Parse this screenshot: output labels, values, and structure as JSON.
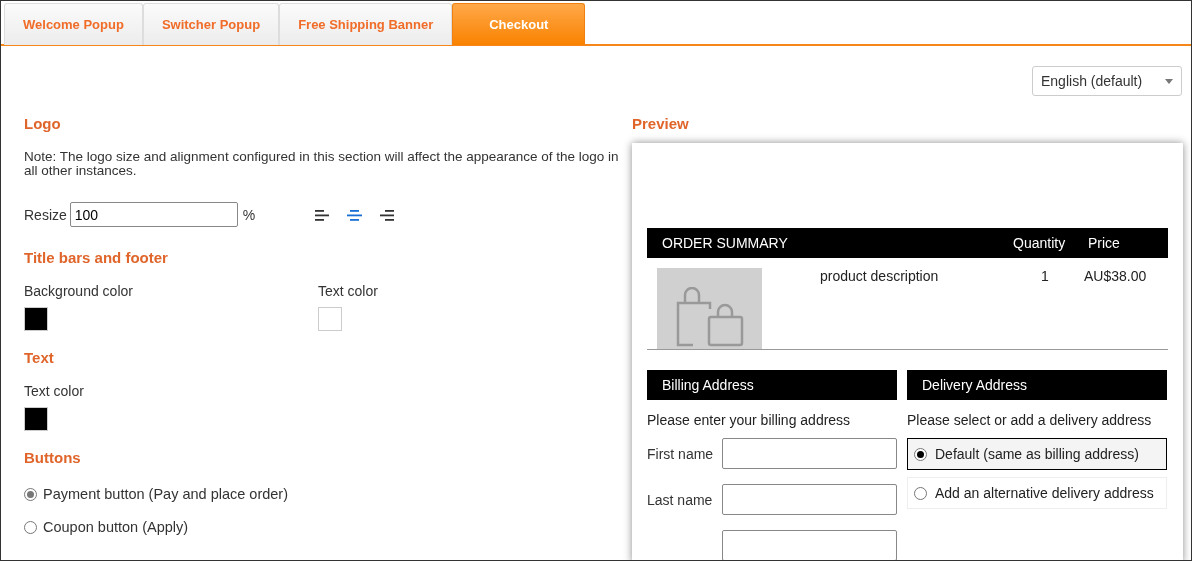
{
  "tabs": [
    {
      "label": "Welcome Popup",
      "selected": false
    },
    {
      "label": "Switcher Popup",
      "selected": false
    },
    {
      "label": "Free Shipping Banner",
      "selected": false
    },
    {
      "label": "Checkout",
      "selected": true
    }
  ],
  "language_select": {
    "value": "English (default)"
  },
  "logo": {
    "heading": "Logo",
    "note": "Note: The logo size and alignment configured in this section will affect the appearance of the logo in all other instances.",
    "resize_label": "Resize",
    "resize_value": "100",
    "unit": "%",
    "alignments": [
      {
        "kind": "left",
        "selected": false
      },
      {
        "kind": "center",
        "selected": true
      },
      {
        "kind": "right",
        "selected": false
      }
    ]
  },
  "title_bars": {
    "heading": "Title bars and footer",
    "colors": [
      {
        "label": "Background color",
        "color": "#000000"
      },
      {
        "label": "Text color",
        "color": "#ffffff"
      }
    ]
  },
  "text": {
    "heading": "Text",
    "colors": [
      {
        "label": "Text color",
        "color": "#000000"
      }
    ]
  },
  "buttons": {
    "heading": "Buttons",
    "options": [
      {
        "label": "Payment button (Pay and place order)",
        "selected": true
      },
      {
        "label": "Coupon button (Apply)",
        "selected": false
      }
    ]
  },
  "preview": {
    "heading": "Preview",
    "order_summary": {
      "title": "ORDER SUMMARY",
      "quantity_header": "Quantity",
      "price_header": "Price",
      "items": [
        {
          "description": "product description",
          "quantity": "1",
          "price": "AU$38.00"
        }
      ]
    },
    "billing": {
      "title": "Billing Address",
      "intro": "Please enter your billing address",
      "fields": [
        {
          "kind": "text",
          "label": "First name"
        },
        {
          "kind": "text",
          "label": "Last name"
        },
        {
          "kind": "text"
        }
      ]
    },
    "delivery": {
      "title": "Delivery Address",
      "intro": "Please select or add a delivery address",
      "options": [
        {
          "label": "Default (same as billing address)",
          "selected": true
        },
        {
          "label": "Add an alternative delivery address",
          "selected": false
        }
      ]
    }
  }
}
